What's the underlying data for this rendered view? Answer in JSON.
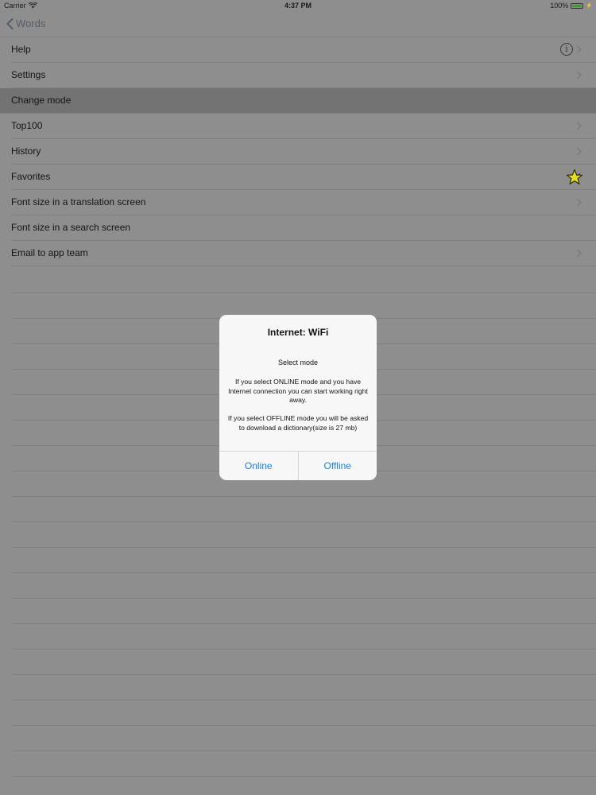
{
  "status_bar": {
    "carrier": "Carrier",
    "time": "4:37 PM",
    "battery": "100%",
    "battery_level": 1.0,
    "icons": [
      "wifi-icon",
      "battery-icon",
      "bolt-icon"
    ]
  },
  "nav": {
    "back_label": "Words",
    "back_icon": "chevron-left-icon"
  },
  "menu": {
    "items": [
      {
        "label": "Help",
        "accessory": "info-icon"
      },
      {
        "label": "Settings",
        "accessory": "chevron-right-icon"
      },
      {
        "label": "Change mode",
        "accessory": "none",
        "selected": true
      },
      {
        "label": "Top100",
        "accessory": "chevron-right-icon"
      },
      {
        "label": "History",
        "accessory": "chevron-right-icon"
      },
      {
        "label": "Favorites",
        "accessory": "star-icon"
      },
      {
        "label": "Font size in a translation screen",
        "accessory": "chevron-right-icon"
      },
      {
        "label": "Font size in a search screen",
        "accessory": "none"
      },
      {
        "label": "Email to app team",
        "accessory": "chevron-right-icon"
      }
    ]
  },
  "alert": {
    "title": "Internet: WiFi",
    "subtitle": "Select mode",
    "message": "If you select ONLINE mode and you have Internet connection you can start working right away.\n\nIf you select OFFLINE mode you will be asked to download a dictionary(size is 27 mb)",
    "buttons": {
      "online": "Online",
      "offline": "Offline"
    }
  },
  "colors": {
    "background": "#8e8e8e",
    "selected_row": "#737373",
    "alert_background": "#f7f7f7",
    "accent": "#1e7fe0",
    "star": "#e6dc22"
  }
}
